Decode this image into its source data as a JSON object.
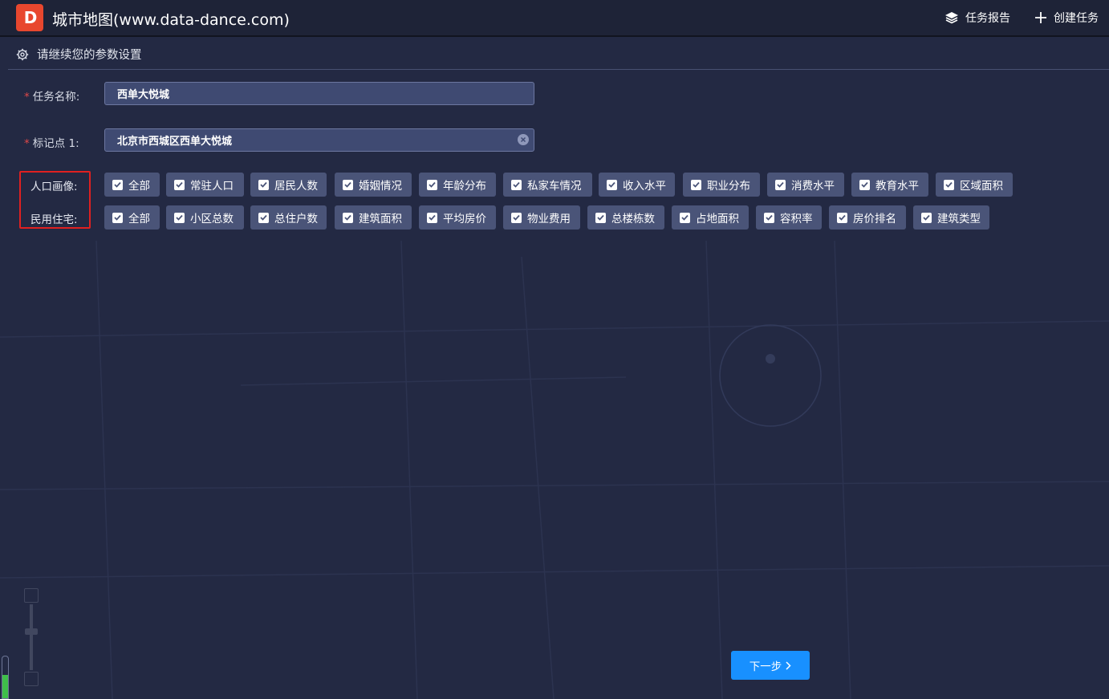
{
  "header": {
    "logo_text": "D",
    "title": "城市地图(www.data-dance.com)",
    "report_label": "任务报告",
    "create_label": "创建任务",
    "report_icon": "layers-icon",
    "create_icon": "plus-icon"
  },
  "section": {
    "title": "请继续您的参数设置",
    "icon": "gear-icon"
  },
  "form": {
    "task_name_label": "任务名称:",
    "task_name_value": "西单大悦城",
    "marker_label": "标记点 1:",
    "marker_value": "北京市西城区西单大悦城",
    "required_mark": "*"
  },
  "population": {
    "label": "人口画像:",
    "options": [
      "全部",
      "常驻人口",
      "居民人数",
      "婚姻情况",
      "年龄分布",
      "私家车情况",
      "收入水平",
      "职业分布",
      "消费水平",
      "教育水平",
      "区域面积"
    ]
  },
  "housing": {
    "label": "民用住宅:",
    "options": [
      "全部",
      "小区总数",
      "总住户数",
      "建筑面积",
      "平均房价",
      "物业费用",
      "总楼栋数",
      "占地面积",
      "容积率",
      "房价排名",
      "建筑类型"
    ]
  },
  "actions": {
    "next_label": "下一步"
  },
  "colors": {
    "accent": "#1890ff",
    "highlight": "#e02020",
    "logo": "#e8472e",
    "background": "#232943"
  }
}
